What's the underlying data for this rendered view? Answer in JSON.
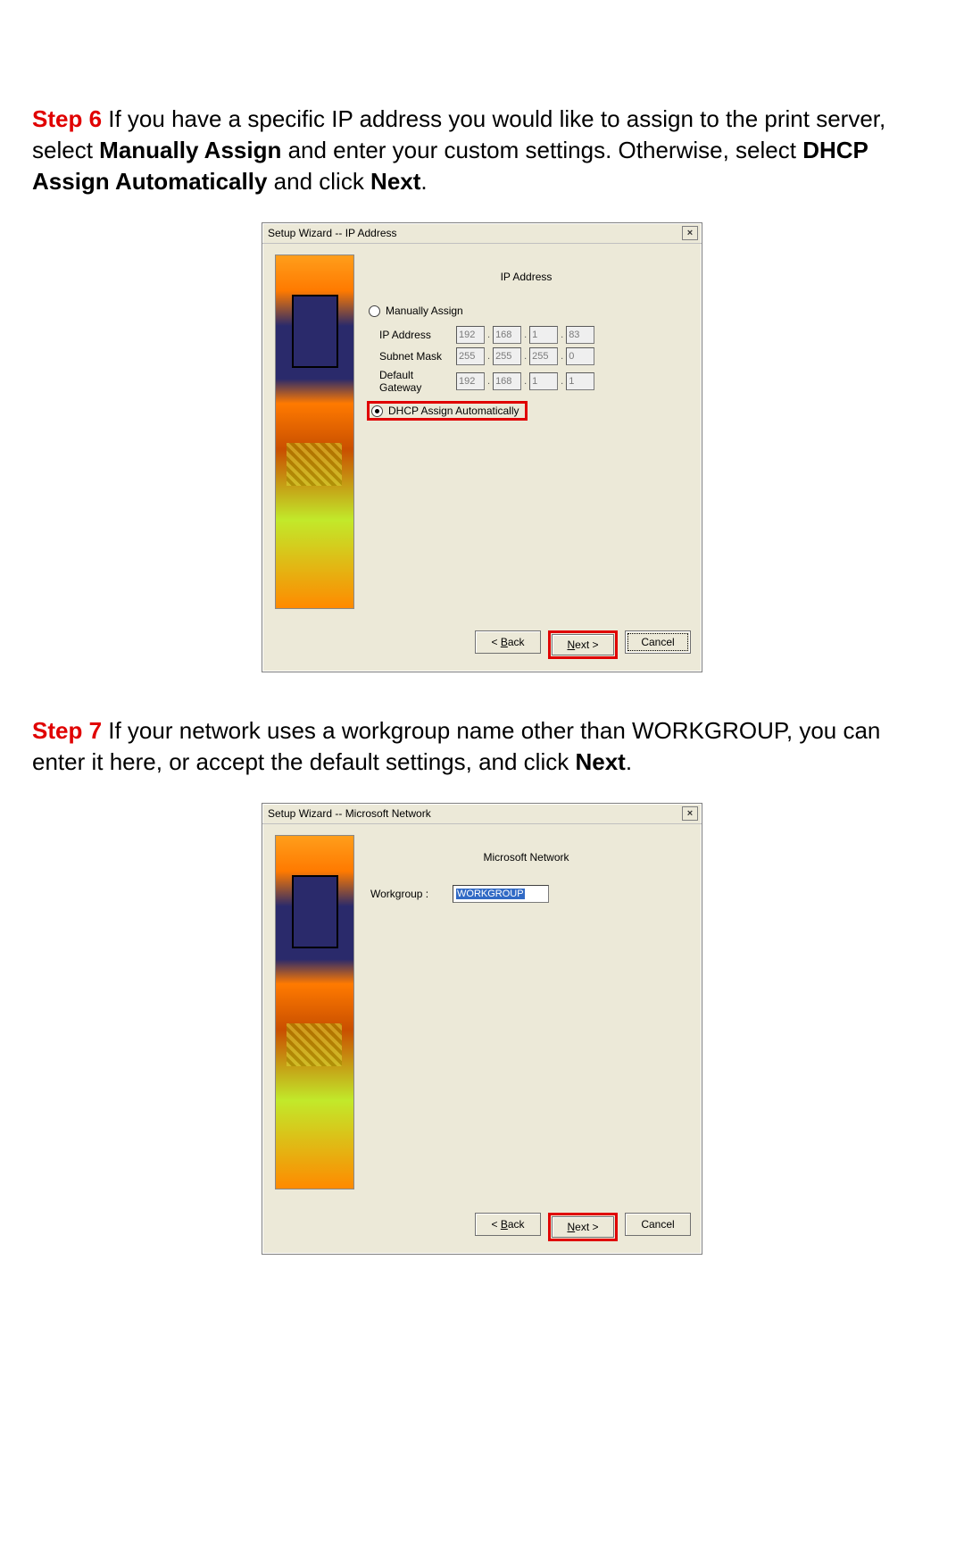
{
  "step6": {
    "label": "Step 6",
    "text_before_bold1": " If you have a specific IP address you would like to assign to the print server, select ",
    "bold1": "Manually Assign",
    "text_mid1": " and enter your custom settings.  Otherwise, select ",
    "bold2": "DHCP Assign Automatically",
    "text_mid2": " and click ",
    "bold3": "Next",
    "text_end": "."
  },
  "win1": {
    "title": "Setup Wizard -- IP Address",
    "panel_title": "IP Address",
    "radio_manual": "Manually Assign",
    "radio_dhcp": "DHCP Assign Automatically",
    "label_ip": "IP Address",
    "label_mask": "Subnet Mask",
    "label_gw": "Default Gateway",
    "ip": [
      "192",
      "168",
      "1",
      "83"
    ],
    "mask": [
      "255",
      "255",
      "255",
      "0"
    ],
    "gw": [
      "192",
      "168",
      "1",
      "1"
    ],
    "btn_back": "< Back",
    "btn_next": "Next >",
    "btn_cancel": "Cancel"
  },
  "step7": {
    "label": "Step 7",
    "text_before": " If your network uses a workgroup name other than WORKGROUP, you can enter it here, or accept the default settings, and click ",
    "bold1": "Next",
    "text_end": "."
  },
  "win2": {
    "title": "Setup Wizard -- Microsoft Network",
    "panel_title": "Microsoft Network",
    "label_workgroup": "Workgroup :",
    "value_workgroup": "WORKGROUP",
    "btn_back": "< Back",
    "btn_next": "Next >",
    "btn_cancel": "Cancel"
  }
}
